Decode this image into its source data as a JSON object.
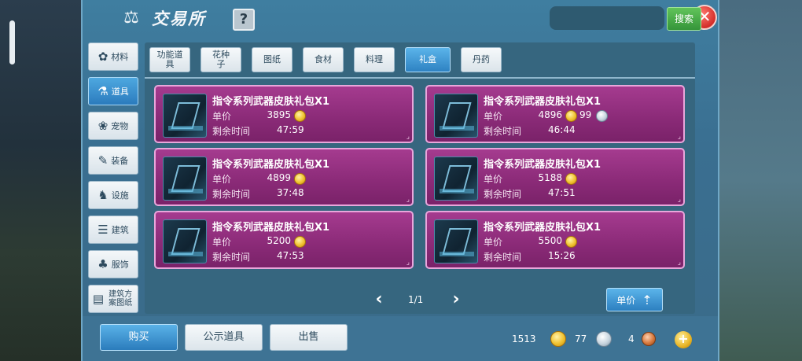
{
  "window": {
    "title": "交易所",
    "help_label": "?",
    "close_label": "✕"
  },
  "sidebar": {
    "items": [
      {
        "label": "材料",
        "icon": "✿"
      },
      {
        "label": "道具",
        "icon": "⚗"
      },
      {
        "label": "宠物",
        "icon": "❀"
      },
      {
        "label": "装备",
        "icon": "✎"
      },
      {
        "label": "设施",
        "icon": "♞"
      },
      {
        "label": "建筑",
        "icon": "☰"
      },
      {
        "label": "服饰",
        "icon": "♣"
      },
      {
        "label": "建筑方案图纸",
        "icon": "▤"
      }
    ],
    "active_index": 1
  },
  "tabs": {
    "items": [
      "功能道具",
      "花种子",
      "图纸",
      "食材",
      "料理",
      "礼盒",
      "丹药"
    ],
    "active_index": 5
  },
  "search": {
    "value": "",
    "placeholder": "",
    "button_label": "搜索"
  },
  "listings": {
    "price_label": "单价",
    "time_label": "剩余时间",
    "items": [
      {
        "name": "指令系列武器皮肤礼包X1",
        "price": "3895",
        "silver": "",
        "time": "47:59"
      },
      {
        "name": "指令系列武器皮肤礼包X1",
        "price": "4896",
        "silver": "99",
        "time": "46:44"
      },
      {
        "name": "指令系列武器皮肤礼包X1",
        "price": "4899",
        "silver": "",
        "time": "37:48"
      },
      {
        "name": "指令系列武器皮肤礼包X1",
        "price": "5188",
        "silver": "",
        "time": "47:51"
      },
      {
        "name": "指令系列武器皮肤礼包X1",
        "price": "5200",
        "silver": "",
        "time": "47:53"
      },
      {
        "name": "指令系列武器皮肤礼包X1",
        "price": "5500",
        "silver": "",
        "time": "15:26"
      }
    ]
  },
  "pager": {
    "text": "1/1",
    "prev": "‹",
    "next": "›"
  },
  "sort": {
    "label": "单价",
    "icon": "⇡"
  },
  "actions": {
    "buy": "购买",
    "public_items": "公示道具",
    "sell": "出售"
  },
  "currency": {
    "gold": "1513",
    "silver": "77",
    "copper": "4",
    "add": "+"
  },
  "colors": {
    "accent": "#2e82c2",
    "card": "#8a2a77",
    "search": "#35953a",
    "close": "#d32e2a"
  }
}
